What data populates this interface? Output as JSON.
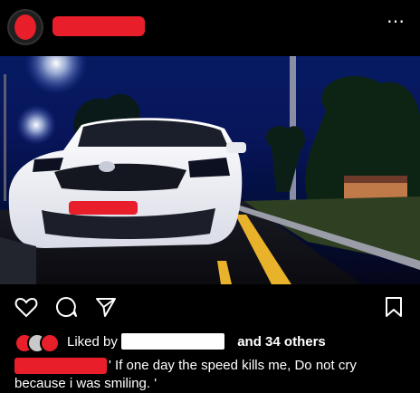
{
  "header": {
    "more_label": "⋯"
  },
  "actions": {
    "like_icon": "heart-icon",
    "comment_icon": "comment-icon",
    "share_icon": "send-icon",
    "save_icon": "bookmark-icon"
  },
  "likes": {
    "prefix": "Liked by",
    "suffix": "and 34 others"
  },
  "caption": {
    "line1": "' If one day the speed kills me, Do not cry",
    "line2": "because i was smiling. '"
  },
  "colors": {
    "redaction": "#e81f2a",
    "background": "#000000",
    "text": "#ffffff",
    "night_sky": "#08155a"
  }
}
